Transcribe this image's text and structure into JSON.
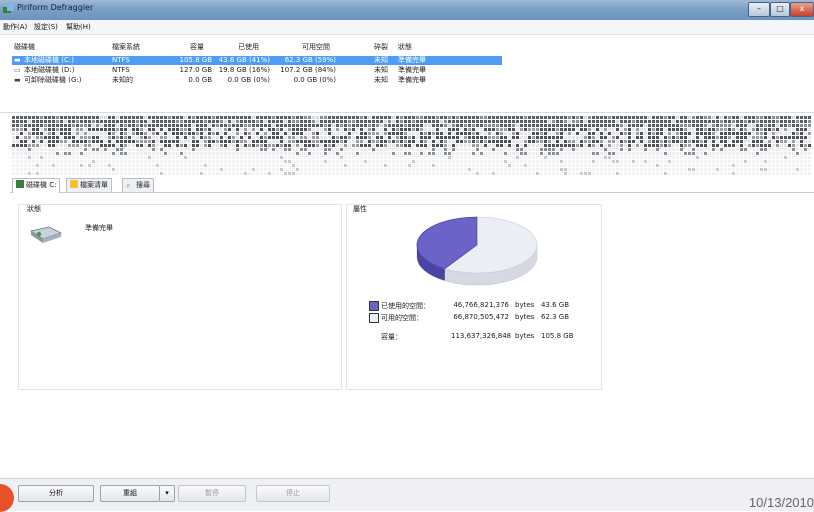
{
  "window": {
    "title": "Piriform Defraggler",
    "min": "–",
    "max": "□",
    "close": "x"
  },
  "menu": [
    "動作(A)",
    "設定(S)",
    "幫助(H)"
  ],
  "drive_table": {
    "columns": [
      "磁碟機",
      "檔案系統",
      "容量",
      "已使用",
      "可用空間",
      "碎裂",
      "狀態"
    ],
    "rows": [
      {
        "name": "本地磁碟機 (C:)",
        "fs": "NTFS",
        "capacity": "105.8 GB",
        "used": "43.6 GB (41%)",
        "free": "62.3 GB (59%)",
        "frag": "未知",
        "status": "準備完畢"
      },
      {
        "name": "本地磁碟機 (D:)",
        "fs": "NTFS",
        "capacity": "127.0 GB",
        "used": "19.8 GB (16%)",
        "free": "107.2 GB (84%)",
        "frag": "未知",
        "status": "準備完畢"
      },
      {
        "name": "可卸除磁碟機 (G:)",
        "fs": "未知的",
        "capacity": "0.0 GB",
        "used": "0.0 GB (0%)",
        "free": "0.0 GB (0%)",
        "frag": "未知",
        "status": "準備完畢"
      }
    ]
  },
  "tabs": [
    "磁碟機 C:",
    "檔案清單",
    "搜尋"
  ],
  "status_panel": {
    "title": "狀態",
    "text": "準備完畢"
  },
  "props_panel": {
    "title": "屬性",
    "used_label": "已使用的空間：",
    "used_bytes": "46,766,821,376",
    "used_gb": "43.6 GB",
    "free_label": "可用的空間：",
    "free_bytes": "66,870,505,472",
    "free_gb": "62.3 GB",
    "cap_label": "容量：",
    "cap_bytes": "113,637,326,848",
    "cap_gb": "105.8 GB",
    "bytes_unit": "bytes",
    "used_fraction": 0.41,
    "used_color": "#6a63c8",
    "free_color": "#eceef5"
  },
  "buttons": {
    "analyze": "分析",
    "defrag": "重組",
    "pause": "暫停",
    "stop": "停止"
  },
  "date": "10/13/2010"
}
